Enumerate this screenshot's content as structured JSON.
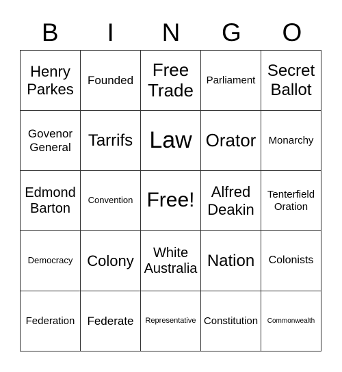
{
  "header": [
    "B",
    "I",
    "N",
    "G",
    "O"
  ],
  "cells": [
    [
      "Henry Parkes",
      "Founded",
      "Free Trade",
      "Parliament",
      "Secret Ballot"
    ],
    [
      "Govenor General",
      "Tarrifs",
      "Law",
      "Orator",
      "Monarchy"
    ],
    [
      "Edmond Barton",
      "Convention",
      "Free!",
      "Alfred Deakin",
      "Tenterfield Oration"
    ],
    [
      "Democracy",
      "Colony",
      "White Australia",
      "Nation",
      "Colonists"
    ],
    [
      "Federation",
      "Federate",
      "Representative",
      "Constitution",
      "Commonwealth"
    ]
  ]
}
